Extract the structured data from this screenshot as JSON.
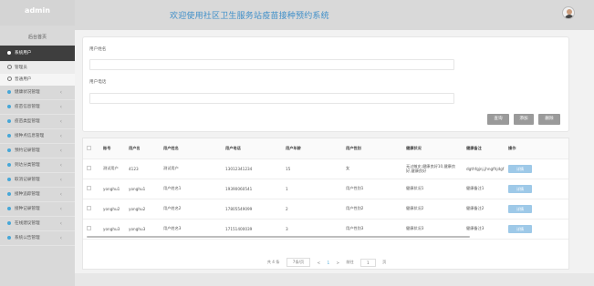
{
  "app": {
    "brand": "admin",
    "header_title": "欢迎使用社区卫生服务站疫苗接种预约系统"
  },
  "sidebar": {
    "home": "后台首页",
    "active_menu": "系统用户",
    "sub_items": [
      "管理员",
      "普通用户"
    ],
    "menus": [
      "健康状况管理",
      "疫苗信息管理",
      "疫苗类型管理",
      "接种点信息管理",
      "预约记录管理",
      "到达分类管理",
      "取消记录管理",
      "接种追踪管理",
      "接种记录管理",
      "在线建议管理",
      "系统公告管理"
    ]
  },
  "search": {
    "name_label": "用户姓名",
    "phone_label": "用户电话",
    "buttons": {
      "query": "查询",
      "add": "添加",
      "delete": "删除"
    }
  },
  "table": {
    "headers": [
      "",
      "账号",
      "用户名",
      "用户姓名",
      "用户电话",
      "用户年龄",
      "用户性别",
      "健康状况",
      "健康备注",
      "操作"
    ],
    "rows": [
      [
        "",
        "测试用户",
        "4123",
        "测试用户",
        "13012341234",
        "15",
        "女",
        "无过敏史,健康良好10,健康良好,健康良好",
        "dgthfgjnj,jhngfhjdgf",
        "详情"
      ],
      [
        "",
        "yonghu1",
        "yonghu1",
        "用户姓名1",
        "19390060541",
        "1",
        "用户性别1",
        "健康状况1",
        "健康备注1",
        "详情"
      ],
      [
        "",
        "yonghu2",
        "yonghu2",
        "用户姓名2",
        "17805549099",
        "2",
        "用户性别2",
        "健康状况2",
        "健康备注2",
        "详情"
      ],
      [
        "",
        "yonghu3",
        "yonghu3",
        "用户姓名3",
        "17151400039",
        "3",
        "用户性别3",
        "健康状况3",
        "健康备注3",
        "详情"
      ]
    ]
  },
  "pager": {
    "total": "共 4 条",
    "page_size": "7条/页",
    "prev": "<",
    "current": "1",
    "next": ">",
    "goto_label": "前往",
    "goto_value": "1",
    "page_unit": "页"
  },
  "colors": {
    "accent": "#46a7d8",
    "header_title": "#3f8fc9",
    "sidebar_active": "#3e3e3e"
  }
}
